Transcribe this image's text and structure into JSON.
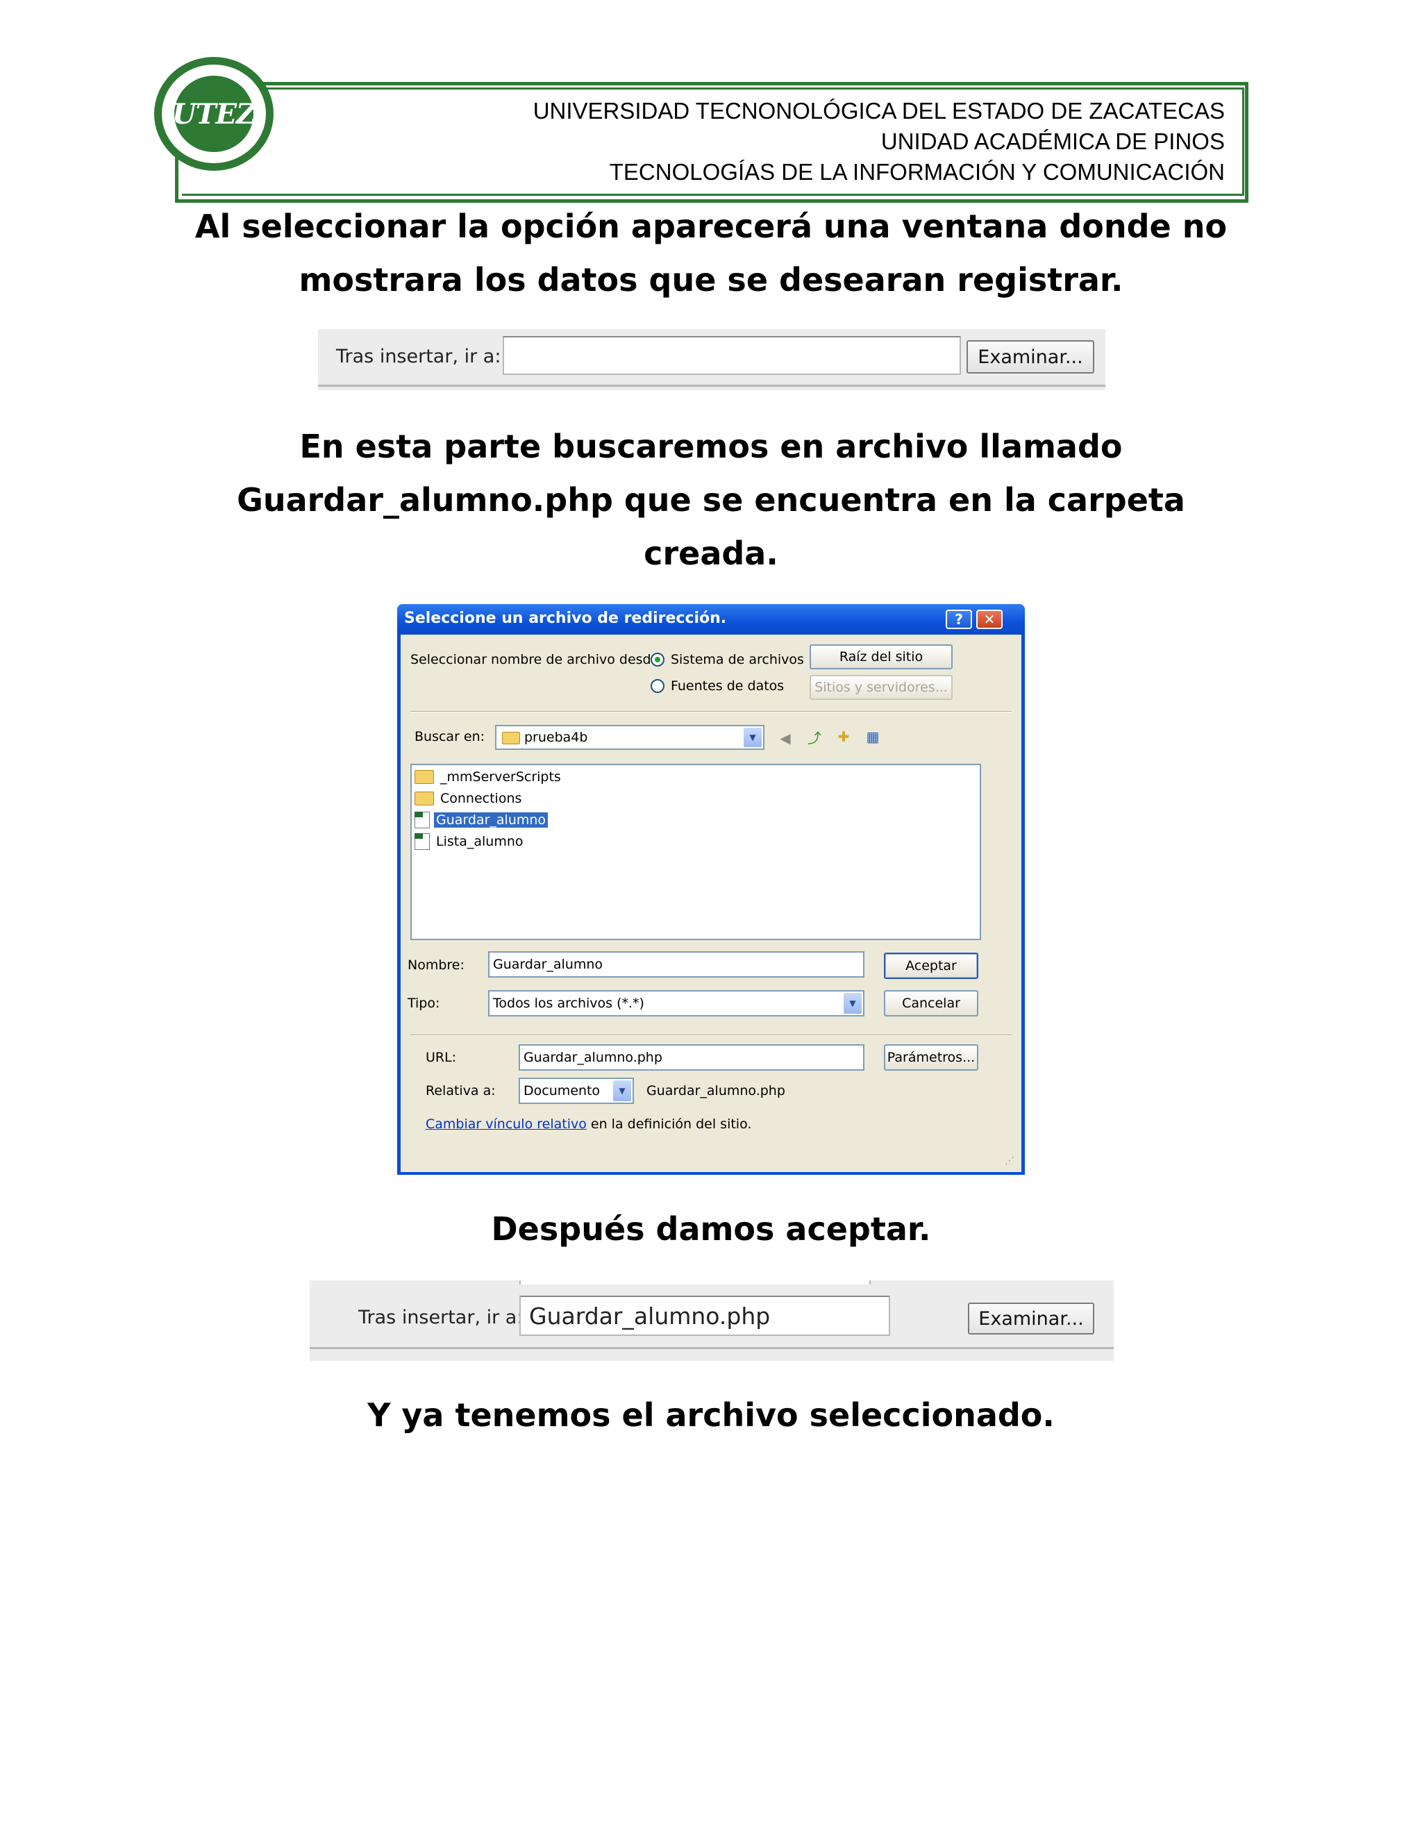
{
  "header": {
    "logo_text": "UTEZ",
    "line1": "UNIVERSIDAD TECNONOLÓGICA DEL ESTADO DE ZACATECAS",
    "line2": "UNIDAD ACADÉMICA DE PINOS",
    "line3": "TECNOLOGÍAS DE LA INFORMACIÓN Y COMUNICACIÓN"
  },
  "paragraphs": {
    "p1_line1": "Al seleccionar la opción aparecerá una ventana donde no",
    "p1_line2": "mostrara los datos que se desearan registrar.",
    "p2_line1": "En esta parte buscaremos en archivo llamado",
    "p2_line2": "Guardar_alumno.php que se encuentra en la carpeta",
    "p2_line3": "creada.",
    "p3": "Después damos aceptar.",
    "p4": "Y ya tenemos el archivo seleccionado."
  },
  "field1": {
    "label": "Tras insertar, ir a:",
    "value": "",
    "button": "Examinar..."
  },
  "field2": {
    "label": "Tras insertar, ir a:",
    "value": "Guardar_alumno.php",
    "button": "Examinar..."
  },
  "dialog": {
    "title": "Seleccione un archivo de redirección.",
    "help_label": "?",
    "close_label": "✕",
    "source_label": "Seleccionar nombre de archivo desde:",
    "radio_filesystem": "Sistema de archivos",
    "radio_datasources": "Fuentes de datos",
    "btn_site_root": "Raíz del sitio",
    "btn_sites_servers": "Sitios y servidores...",
    "lookin_label": "Buscar en:",
    "lookin_value": "prueba4b",
    "files": [
      {
        "name": "_mmServerScripts",
        "type": "folder"
      },
      {
        "name": "Connections",
        "type": "folder"
      },
      {
        "name": "Guardar_alumno",
        "type": "php",
        "selected": true
      },
      {
        "name": "Lista_alumno",
        "type": "php"
      }
    ],
    "name_label": "Nombre:",
    "name_value": "Guardar_alumno",
    "type_label": "Tipo:",
    "type_value": "Todos los archivos (*.*)",
    "btn_accept": "Aceptar",
    "btn_cancel": "Cancelar",
    "url_label": "URL:",
    "url_value": "Guardar_alumno.php",
    "btn_params": "Parámetros...",
    "relative_label": "Relativa a:",
    "relative_value": "Documento",
    "relative_file": "Guardar_alumno.php",
    "link_text": "Cambiar vínculo relativo",
    "link_suffix": "en la definición del sitio."
  }
}
